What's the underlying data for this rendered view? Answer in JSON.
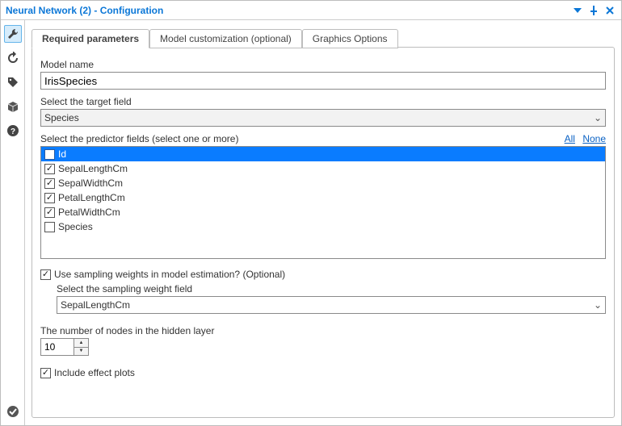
{
  "title": "Neural Network (2) - Configuration",
  "tabs": {
    "t0": "Required parameters",
    "t1": "Model customization (optional)",
    "t2": "Graphics Options"
  },
  "labels": {
    "model_name": "Model name",
    "target": "Select the target field",
    "predictors": "Select the predictor fields (select one or more)",
    "all": "All",
    "none": "None",
    "sampling_chk": "Use sampling weights in model estimation? (Optional)",
    "sampling_field": "Select the sampling weight field",
    "hidden_nodes": "The number of nodes in the hidden layer",
    "effect_plots": "Include effect plots"
  },
  "values": {
    "model_name": "IrisSpecies",
    "target": "Species",
    "sampling_field": "SepalLengthCm",
    "hidden_nodes": "10"
  },
  "predictor_fields": {
    "0": {
      "label": "Id",
      "checked": "false",
      "selected": "true"
    },
    "1": {
      "label": "SepalLengthCm",
      "checked": "true",
      "selected": "false"
    },
    "2": {
      "label": "SepalWidthCm",
      "checked": "true",
      "selected": "false"
    },
    "3": {
      "label": "PetalLengthCm",
      "checked": "true",
      "selected": "false"
    },
    "4": {
      "label": "PetalWidthCm",
      "checked": "true",
      "selected": "false"
    },
    "5": {
      "label": "Species",
      "checked": "false",
      "selected": "false"
    }
  },
  "states": {
    "sampling_checked": "true",
    "effect_plots_checked": "true"
  }
}
